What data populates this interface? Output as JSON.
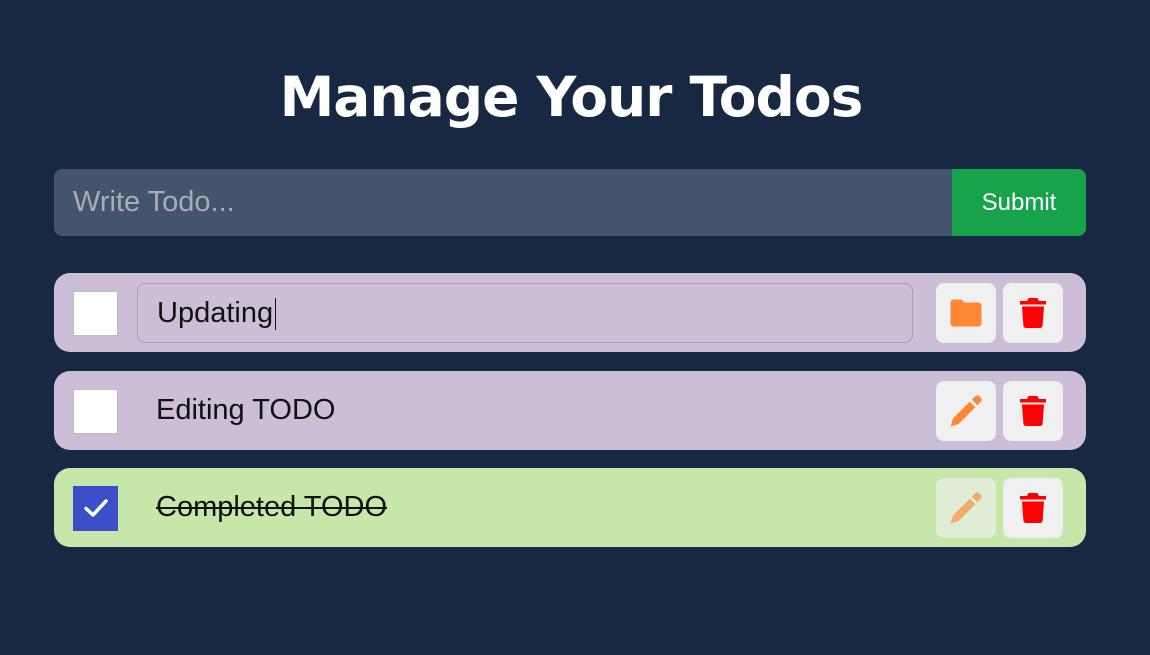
{
  "page": {
    "title": "Manage Your Todos"
  },
  "form": {
    "placeholder": "Write Todo...",
    "value": "",
    "submit_label": "Submit"
  },
  "todos": [
    {
      "text": "Updating",
      "completed": false,
      "editing": true,
      "edit_icon": "folder-icon",
      "delete_icon": "trash-icon",
      "background": "#ccbed7"
    },
    {
      "text": "Editing TODO",
      "completed": false,
      "editing": false,
      "edit_icon": "pencil-icon",
      "delete_icon": "trash-icon",
      "background": "#ccbed7"
    },
    {
      "text": "Completed TODO",
      "completed": true,
      "editing": false,
      "edit_icon": "pencil-icon",
      "delete_icon": "trash-icon",
      "background": "#c6e7a9"
    }
  ],
  "colors": {
    "page_background": "#172842",
    "input_background": "#44546c",
    "submit_button": "#16a34a",
    "edit_icon": "#fd8833",
    "delete_icon": "#ff0000",
    "checkbox_checked": "#3b4fc8"
  }
}
